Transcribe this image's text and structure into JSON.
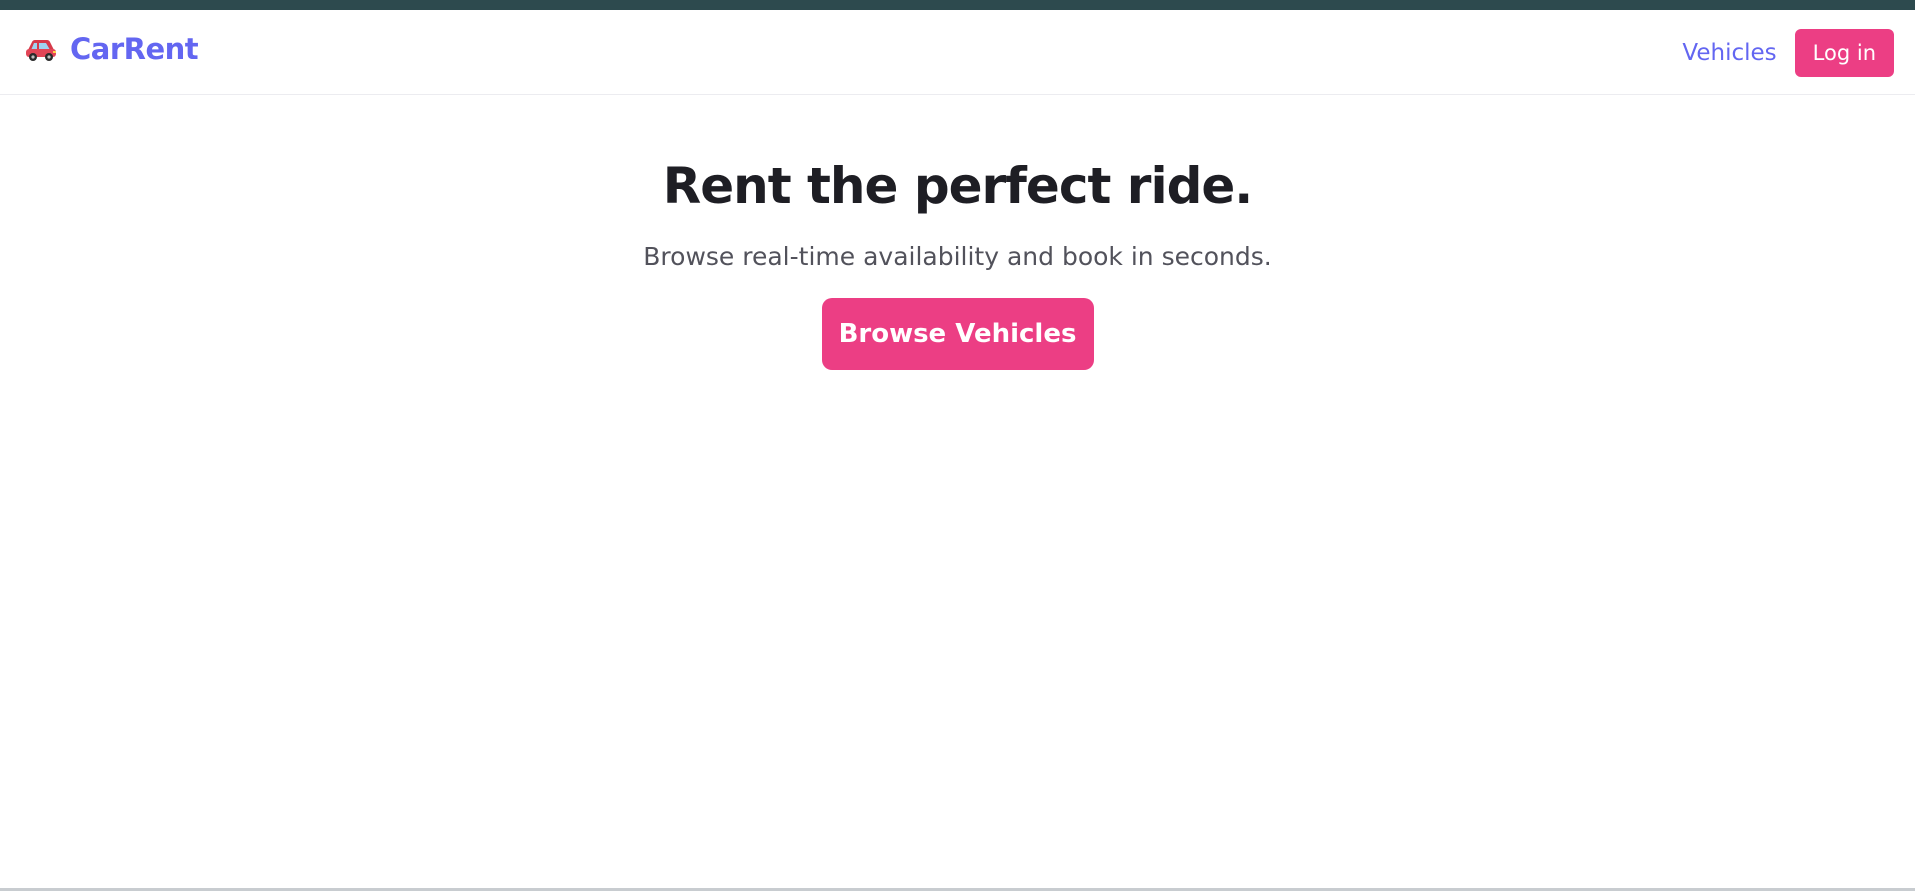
{
  "navbar": {
    "brand_icon": "car-icon",
    "brand_name": "CarRent",
    "links": [
      {
        "label": "Vehicles"
      }
    ],
    "login_label": "Log in"
  },
  "hero": {
    "title": "Rent the perfect ride.",
    "subtitle": "Browse real-time availability and book in seconds.",
    "cta_label": "Browse Vehicles"
  },
  "colors": {
    "brand": "#6366f1",
    "accent": "#ec3e84",
    "heading": "#1e1e24",
    "muted": "#52525b",
    "top_strip": "#2d4a4e"
  }
}
